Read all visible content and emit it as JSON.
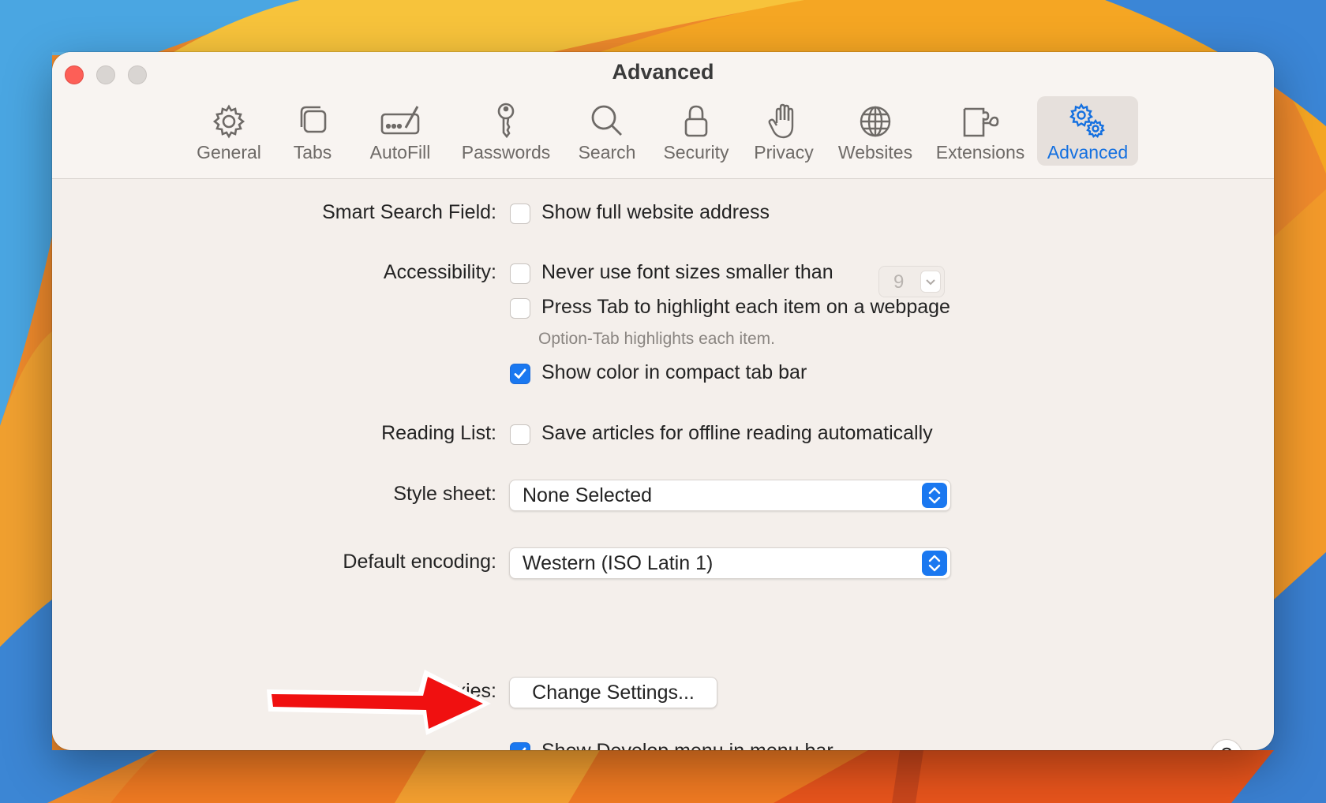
{
  "window": {
    "title": "Advanced"
  },
  "toolbar": {
    "items": [
      {
        "label": "General",
        "icon": "gear-icon"
      },
      {
        "label": "Tabs",
        "icon": "tabs-icon"
      },
      {
        "label": "AutoFill",
        "icon": "autofill-icon"
      },
      {
        "label": "Passwords",
        "icon": "key-icon"
      },
      {
        "label": "Search",
        "icon": "magnifier-icon"
      },
      {
        "label": "Security",
        "icon": "lock-icon"
      },
      {
        "label": "Privacy",
        "icon": "hand-icon"
      },
      {
        "label": "Websites",
        "icon": "globe-icon"
      },
      {
        "label": "Extensions",
        "icon": "puzzle-icon"
      },
      {
        "label": "Advanced",
        "icon": "gears-icon"
      }
    ],
    "active": "Advanced",
    "accent_color": "#1470e0"
  },
  "settings": {
    "smart_search": {
      "label": "Smart Search Field:",
      "show_full_address": {
        "text": "Show full website address",
        "checked": false
      }
    },
    "accessibility": {
      "label": "Accessibility:",
      "min_font": {
        "text": "Never use font sizes smaller than",
        "checked": false,
        "value": "9"
      },
      "press_tab": {
        "text": "Press Tab to highlight each item on a webpage",
        "checked": false
      },
      "hint": "Option-Tab highlights each item.",
      "show_color": {
        "text": "Show color in compact tab bar",
        "checked": true
      }
    },
    "reading_list": {
      "label": "Reading List:",
      "save_offline": {
        "text": "Save articles for offline reading automatically",
        "checked": false
      }
    },
    "style_sheet": {
      "label": "Style sheet:",
      "value": "None Selected"
    },
    "default_encoding": {
      "label": "Default encoding:",
      "value": "Western (ISO Latin 1)"
    },
    "proxies": {
      "label": "Proxies:",
      "button": "Change Settings..."
    },
    "develop_menu": {
      "text": "Show Develop menu in menu bar",
      "checked": true
    }
  },
  "help": {
    "label": "?"
  },
  "colors": {
    "checkbox_checked": "#1a78f0",
    "annotation_arrow": "#f01010"
  }
}
